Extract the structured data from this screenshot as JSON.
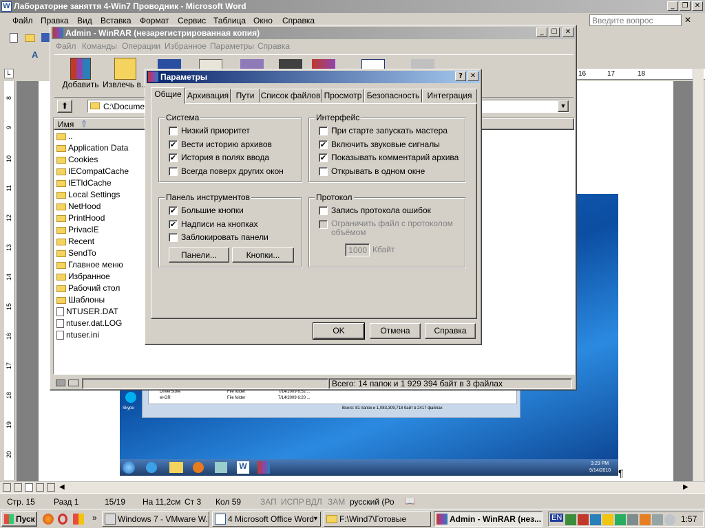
{
  "word": {
    "title": "Лабораторне заняття 4-Win7 Проводник - Microsoft Word",
    "menus": [
      "Файл",
      "Правка",
      "Вид",
      "Вставка",
      "Формат",
      "Сервис",
      "Таблица",
      "Окно",
      "Справка"
    ],
    "help_placeholder": "Введите вопрос",
    "ruler_marks": [
      "16",
      "17",
      "18"
    ],
    "vruler": [
      "8",
      "9",
      "10",
      "11",
      "12",
      "13",
      "14",
      "15",
      "16",
      "17",
      "18",
      "19",
      "20"
    ],
    "status": {
      "page": "Стр. 15",
      "section": "Разд 1",
      "pages": "15/19",
      "at": "На 11,2см",
      "line": "Ст 3",
      "col": "Кол 59",
      "rec": "ЗАП",
      "trk": "ИСПР",
      "ext": "ВДЛ",
      "ovr": "ЗАМ",
      "lang": "русский (Ро"
    },
    "pilcrow": "¶"
  },
  "embedded": {
    "rows": [
      {
        "name": "DriverStore",
        "type": "File folder",
        "date": "7/14/2009 6:52 ..."
      },
      {
        "name": "el-GR",
        "type": "File folder",
        "date": "7/14/2009 6:20 ..."
      }
    ],
    "status": "Всего: 81 папок и 1,083,309,718 байт в 2417 файлах",
    "desktop_icon": "Skype",
    "clock_time": "3:29 PM",
    "clock_date": "9/14/2010"
  },
  "winrar": {
    "title": "Admin - WinRAR (незарегистрированная копия)",
    "menus": [
      "Файл",
      "Команды",
      "Операции",
      "Избранное",
      "Параметры",
      "Справка"
    ],
    "toolbar": {
      "add": "Добавить",
      "extract": "Извлечь в..."
    },
    "path": "C:\\Documen",
    "column_name": "Имя",
    "files": [
      "..",
      "Application Data",
      "Cookies",
      "IECompatCache",
      "IETldCache",
      "Local Settings",
      "NetHood",
      "PrintHood",
      "PrivacIE",
      "Recent",
      "SendTo",
      "Главное меню",
      "Избранное",
      "Рабочий стол",
      "Шаблоны",
      "NTUSER.DAT",
      "ntuser.dat.LOG",
      "ntuser.ini"
    ],
    "status": "Всего: 14 папок и 1 929 394 байт в 3 файлах"
  },
  "dialog": {
    "title": "Параметры",
    "tabs": [
      "Общие",
      "Архивация",
      "Пути",
      "Список файлов",
      "Просмотр",
      "Безопасность",
      "Интеграция"
    ],
    "system": {
      "title": "Система",
      "items": [
        {
          "label": "Низкий приоритет",
          "checked": false
        },
        {
          "label": "Вести историю архивов",
          "checked": true
        },
        {
          "label": "История в полях ввода",
          "checked": true
        },
        {
          "label": "Всегда поверх других окон",
          "checked": false
        }
      ]
    },
    "interface": {
      "title": "Интерфейс",
      "items": [
        {
          "label": "При старте запускать мастера",
          "checked": false
        },
        {
          "label": "Включить звуковые сигналы",
          "checked": true
        },
        {
          "label": "Показывать комментарий архива",
          "checked": true
        },
        {
          "label": "Открывать в одном окне",
          "checked": false
        }
      ]
    },
    "toolbar_panel": {
      "title": "Панель инструментов",
      "items": [
        {
          "label": "Большие кнопки",
          "checked": true
        },
        {
          "label": "Надписи на кнопках",
          "checked": true
        },
        {
          "label": "Заблокировать панели",
          "checked": false
        }
      ],
      "panels_button": "Панели...",
      "buttons_button": "Кнопки..."
    },
    "protocol": {
      "title": "Протокол",
      "log_errors": {
        "label": "Запись протокола ошибок",
        "checked": false
      },
      "limit_label_1": "Ограничить файл с протоколом",
      "limit_label_2": "объёмом",
      "limit_value": "1000",
      "limit_unit": "Кбайт"
    },
    "ok": "OK",
    "cancel": "Отмена",
    "help": "Справка"
  },
  "taskbar": {
    "start": "Пуск",
    "buttons": [
      "Windows 7 - VMware W...",
      "4 Microsoft Office Word",
      "F:\\Wind7\\Готовые",
      "Admin - WinRAR (нез..."
    ],
    "lang": "EN",
    "clock": "1:57"
  }
}
